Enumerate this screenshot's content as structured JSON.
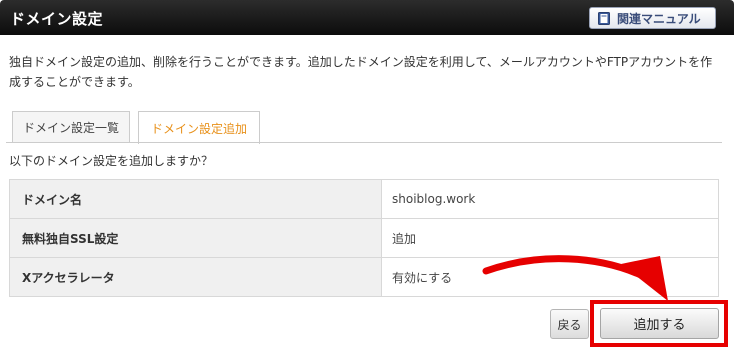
{
  "header": {
    "title": "ドメイン設定",
    "manual_button": "関連マニュアル"
  },
  "description": "独自ドメイン設定の追加、削除を行うことができます。追加したドメイン設定を利用して、メールアカウントやFTPアカウントを作成することができます。",
  "tabs": {
    "list_label": "ドメイン設定一覧",
    "add_label": "ドメイン設定追加",
    "active": "ドメイン設定追加"
  },
  "confirm_question": "以下のドメイン設定を追加しますか？",
  "settings_table": {
    "rows": [
      {
        "key": "ドメイン名",
        "value": "shoiblog.work"
      },
      {
        "key": "無料独自SSL設定",
        "value": "追加"
      },
      {
        "key": "Xアクセラレータ",
        "value": "有効にする"
      }
    ]
  },
  "actions": {
    "back_label": "戻る",
    "submit_label": "追加する"
  },
  "colors": {
    "header_bg": "#1a1a1a",
    "active_tab_text": "#e8911b",
    "annotation_red": "#e60000"
  },
  "icons": {
    "manual": "book-icon",
    "annotation": "curved-arrow-icon"
  }
}
